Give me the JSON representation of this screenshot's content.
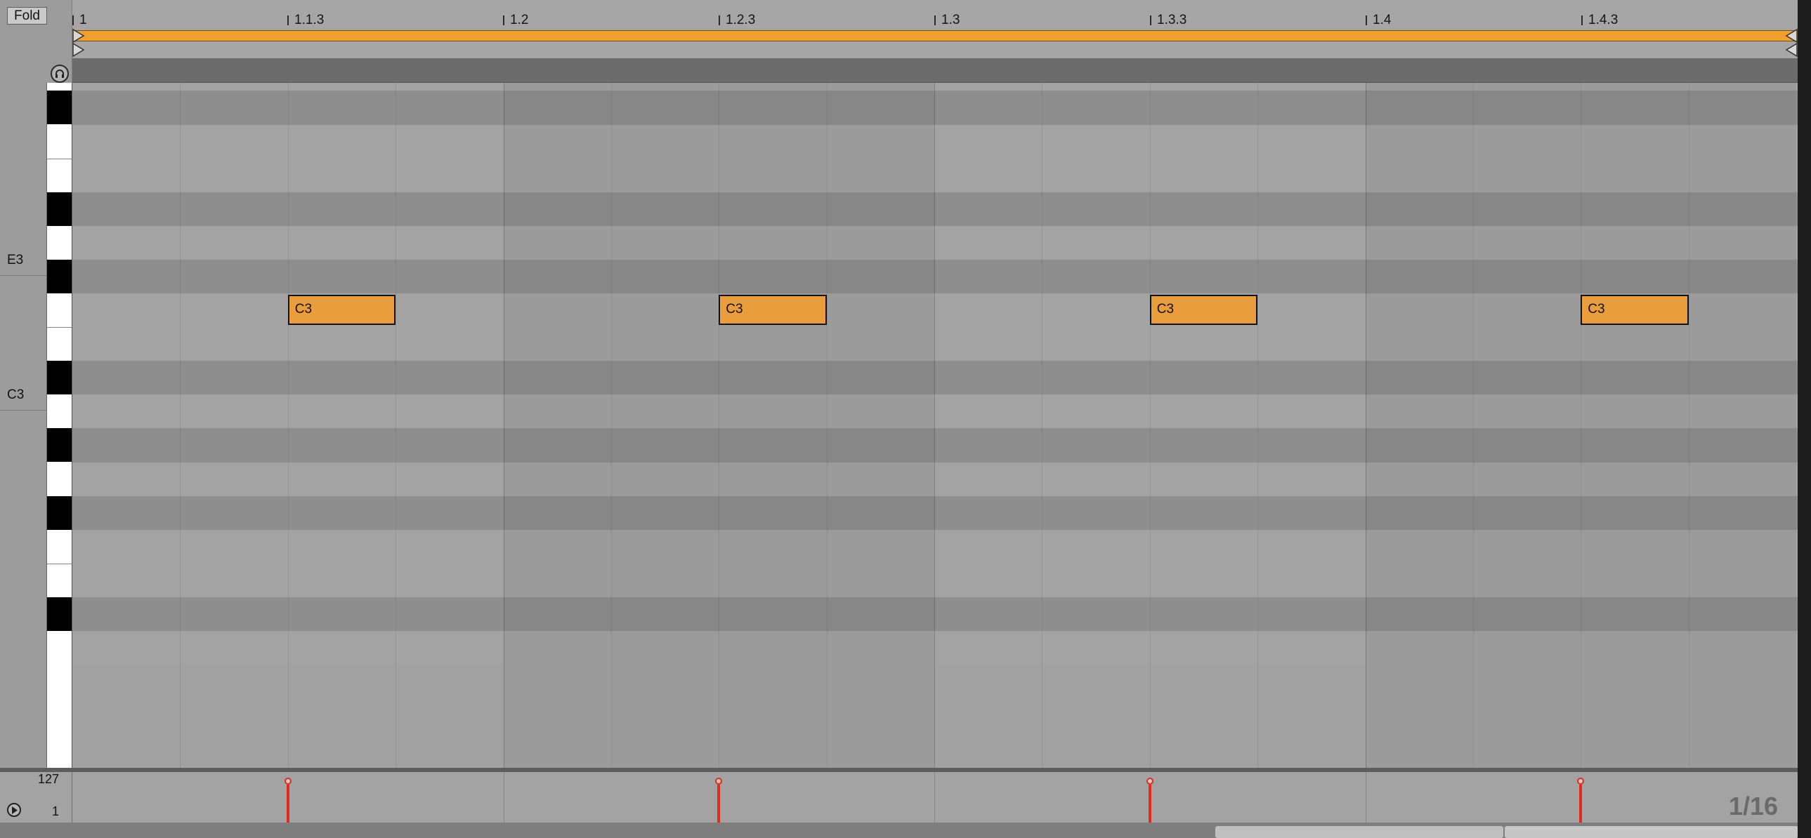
{
  "editor": {
    "fold_label": "Fold",
    "ruler_labels": [
      "1",
      "1.1.3",
      "1.2",
      "1.2.3",
      "1.3",
      "1.3.3",
      "1.4",
      "1.4.3"
    ],
    "key_labels": {
      "e3": "E3",
      "c3": "C3"
    },
    "notes": [
      {
        "pitch": "C3",
        "start": 0.5,
        "length": 0.25,
        "velocity": 127
      },
      {
        "pitch": "C3",
        "start": 1.5,
        "length": 0.25,
        "velocity": 127
      },
      {
        "pitch": "C3",
        "start": 2.5,
        "length": 0.25,
        "velocity": 127
      },
      {
        "pitch": "C3",
        "start": 3.5,
        "length": 0.25,
        "velocity": 127
      }
    ],
    "velocity_max": "127",
    "velocity_min": "1",
    "grid_setting": "1/16",
    "colors": {
      "note": "#ea9d3b",
      "loop": "#f0a02c",
      "velocity": "#e32a1c"
    },
    "icons": {
      "preview": "headphones-icon",
      "velocity_play": "play-icon"
    }
  }
}
